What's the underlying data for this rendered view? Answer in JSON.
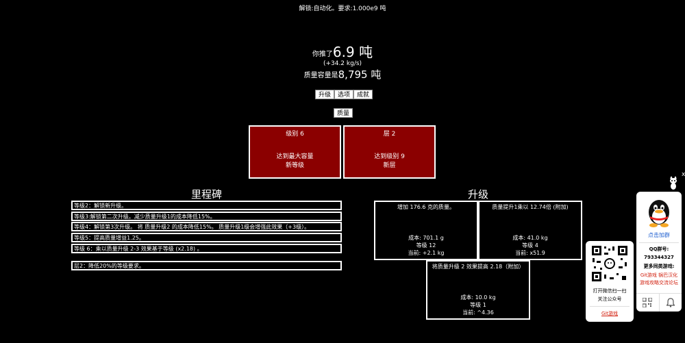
{
  "header": {
    "unlock_text": "解锁:自动化。要求:1.000e9 吨",
    "push_prefix": "你推了",
    "push_value": "6.9 吨",
    "rate": "(+34.2 kg/s)",
    "cap_prefix": "质量容量是",
    "cap_value": "8,795 吨"
  },
  "tabs": [
    {
      "label": "升级"
    },
    {
      "label": "选项"
    },
    {
      "label": "成就"
    }
  ],
  "subtab": {
    "label": "质量"
  },
  "resets": [
    {
      "title": "级别 6",
      "req": "达到最大容量",
      "action": "新等级"
    },
    {
      "title": "层 2",
      "req": "达到级别 9",
      "action": "新层"
    }
  ],
  "milestones": {
    "title": "里程碑",
    "items": [
      "等级2：解锁新升级。",
      "等级3:解锁第二次升级。减少质量升级1的成本降低15%。",
      "等级4：解锁第3次升级。 将 质量升级2 的成本降低15%。 质量升级1级会增强此效果（+3级）。",
      "等级5：提高质量增益1.25。",
      "等级 6：乘以质量升级 2-3 效果基于等级 (x2.18) 。",
      "层2：降低20%的等级要求。"
    ]
  },
  "upgrades": {
    "title": "升级",
    "items": [
      {
        "desc": "增加 176.6 克的质量。",
        "cost": "成本: 701.1 g",
        "level": "等级 12",
        "current": "当前: +2.1 kg"
      },
      {
        "desc": "质量提升1乘以 12.74倍 (附加)",
        "cost": "成本: 41.0 kg",
        "level": "等级 4",
        "current": "当前: x51.9"
      },
      {
        "desc": "将质量升级 2 效果提高 2.18（附加）",
        "cost": "成本: 10.0 kg",
        "level": "等级 1",
        "current": "当前: ^4.36"
      }
    ]
  },
  "side_widget": {
    "close": "x",
    "join_label": "点击加群",
    "qq_label": "QQ群号:",
    "qq_number": "793344327",
    "more_games": "更多同类游戏:",
    "link1": "Git游戏",
    "link2": "锅巴汉化",
    "link3": "游戏攻略交流论坛"
  },
  "wechat_widget": {
    "line1": "打开微信扫一扫",
    "line2": "关注公众号",
    "link": "Git游戏"
  }
}
